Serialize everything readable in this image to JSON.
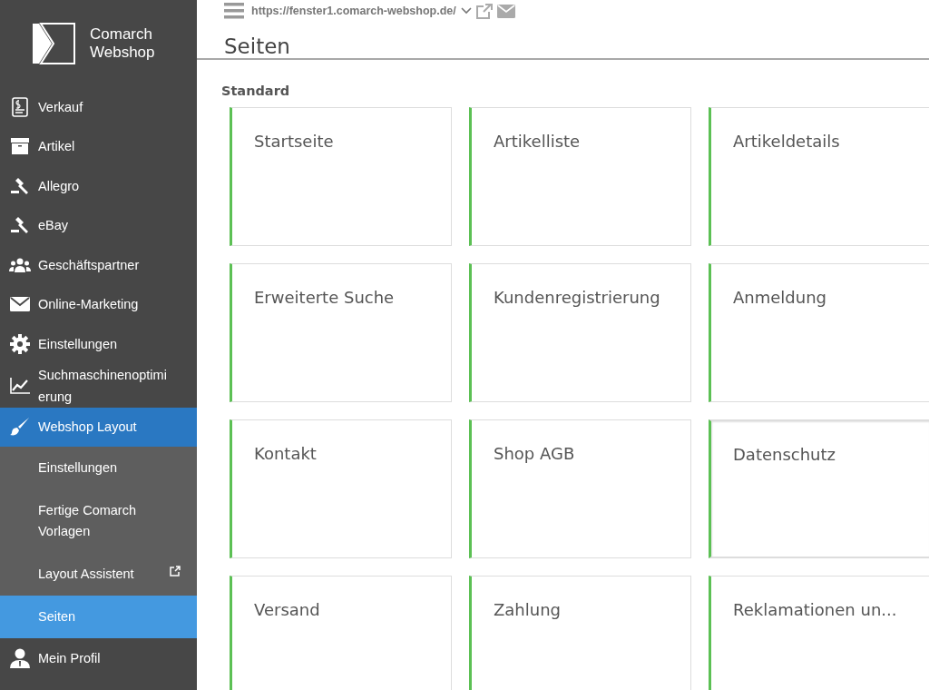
{
  "logo": {
    "line1": "Comarch",
    "line2": "Webshop"
  },
  "sidebar": {
    "items": [
      {
        "label": "Verkauf",
        "selected": false
      },
      {
        "label": "Artikel",
        "selected": false
      },
      {
        "label": "Allegro",
        "selected": false
      },
      {
        "label": "eBay",
        "selected": false
      },
      {
        "label": "Geschäftspartner",
        "selected": false
      },
      {
        "label": "Online-Marketing",
        "selected": false
      },
      {
        "label": "Einstellungen",
        "selected": false
      },
      {
        "label": "Suchmaschinenoptimierung",
        "selected": false
      },
      {
        "label": "Webshop Layout",
        "selected": true,
        "expanded": true,
        "children": [
          {
            "label": "Einstellungen",
            "selected": false,
            "external": false
          },
          {
            "label": "Fertige Comarch Vorlagen",
            "selected": false,
            "external": false
          },
          {
            "label": "Layout Assistent",
            "selected": false,
            "external": true
          },
          {
            "label": "Seiten",
            "selected": true,
            "external": false
          }
        ]
      },
      {
        "label": "Mein Profil",
        "selected": false
      }
    ]
  },
  "topbar": {
    "url": "https://fenster1.comarch-webshop.de/"
  },
  "page_title": "Seiten",
  "section": {
    "title": "Standard",
    "cards": [
      {
        "label": "Startseite",
        "hovered": false
      },
      {
        "label": "Artikelliste",
        "hovered": false
      },
      {
        "label": "Artikeldetails",
        "hovered": false
      },
      {
        "label": "Erweiterte Suche",
        "hovered": false
      },
      {
        "label": "Kundenregistrierung",
        "hovered": false
      },
      {
        "label": "Anmeldung",
        "hovered": false
      },
      {
        "label": "Kontakt",
        "hovered": false
      },
      {
        "label": "Shop AGB",
        "hovered": false
      },
      {
        "label": "Datenschutz",
        "hovered": true
      },
      {
        "label": "Versand",
        "hovered": false
      },
      {
        "label": "Zahlung",
        "hovered": false
      },
      {
        "label": "Reklamationen un...",
        "hovered": false
      }
    ]
  }
}
